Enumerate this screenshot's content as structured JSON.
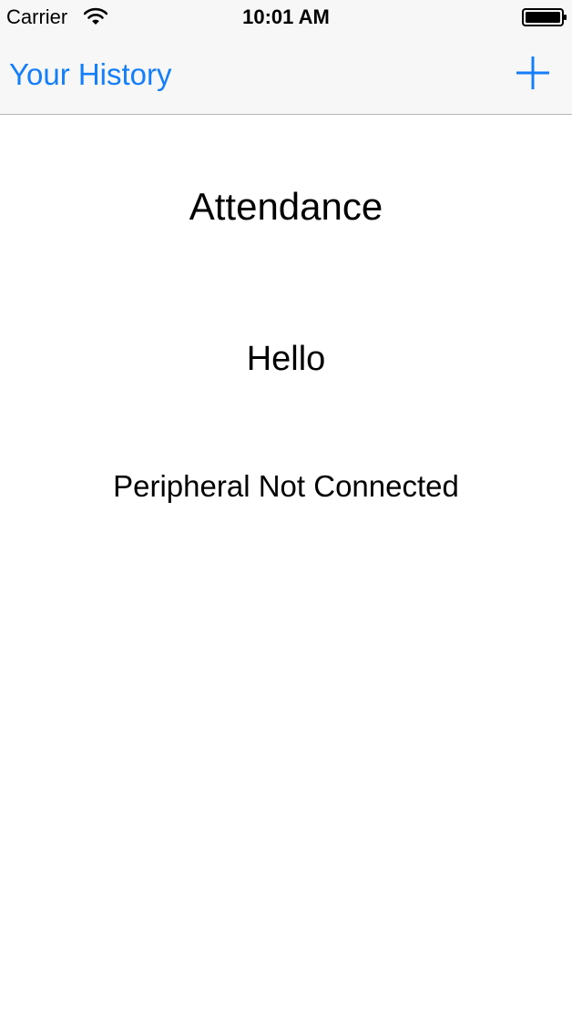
{
  "status_bar": {
    "carrier": "Carrier",
    "time": "10:01 AM",
    "icons": [
      "wifi-icon",
      "battery-icon"
    ]
  },
  "nav": {
    "back_label": "Your History",
    "add_icon": "plus-icon",
    "accent_color": "#147efb"
  },
  "main": {
    "title": "Attendance",
    "greeting": "Hello",
    "peripheral_status": "Peripheral Not Connected"
  }
}
